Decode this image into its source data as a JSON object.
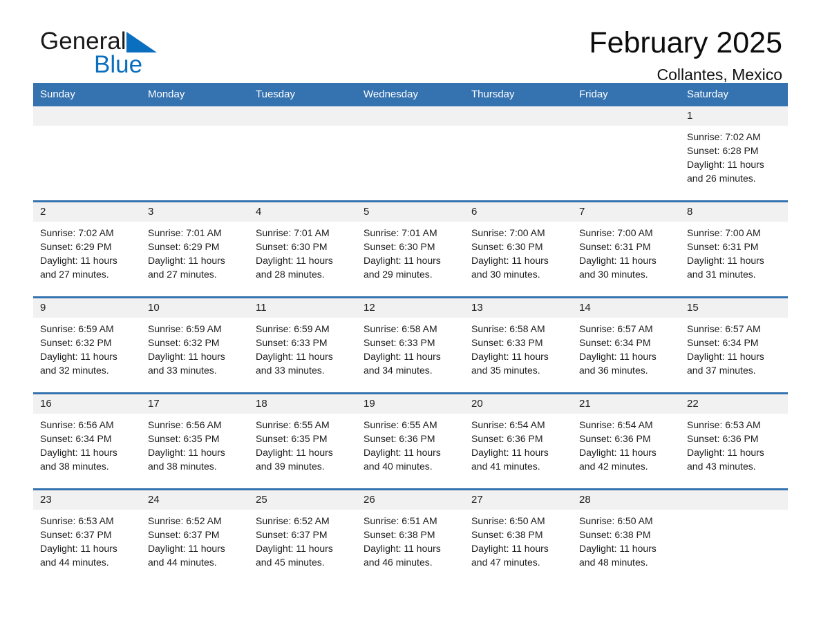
{
  "brand": {
    "word_general": "General",
    "word_blue": "Blue",
    "triangle_color": "#0b6fc0"
  },
  "header": {
    "title": "February 2025",
    "subtitle": "Collantes, Mexico",
    "accent_color": "#3572b0",
    "daynum_band_color": "#f1f1f1"
  },
  "calendar": {
    "weekday_headers": [
      "Sunday",
      "Monday",
      "Tuesday",
      "Wednesday",
      "Thursday",
      "Friday",
      "Saturday"
    ],
    "weeks": [
      [
        {
          "day": "",
          "lines": [
            "",
            "",
            "",
            ""
          ]
        },
        {
          "day": "",
          "lines": [
            "",
            "",
            "",
            ""
          ]
        },
        {
          "day": "",
          "lines": [
            "",
            "",
            "",
            ""
          ]
        },
        {
          "day": "",
          "lines": [
            "",
            "",
            "",
            ""
          ]
        },
        {
          "day": "",
          "lines": [
            "",
            "",
            "",
            ""
          ]
        },
        {
          "day": "",
          "lines": [
            "",
            "",
            "",
            ""
          ]
        },
        {
          "day": "1",
          "lines": [
            "Sunrise: 7:02 AM",
            "Sunset: 6:28 PM",
            "Daylight: 11 hours",
            "and 26 minutes."
          ]
        }
      ],
      [
        {
          "day": "2",
          "lines": [
            "Sunrise: 7:02 AM",
            "Sunset: 6:29 PM",
            "Daylight: 11 hours",
            "and 27 minutes."
          ]
        },
        {
          "day": "3",
          "lines": [
            "Sunrise: 7:01 AM",
            "Sunset: 6:29 PM",
            "Daylight: 11 hours",
            "and 27 minutes."
          ]
        },
        {
          "day": "4",
          "lines": [
            "Sunrise: 7:01 AM",
            "Sunset: 6:30 PM",
            "Daylight: 11 hours",
            "and 28 minutes."
          ]
        },
        {
          "day": "5",
          "lines": [
            "Sunrise: 7:01 AM",
            "Sunset: 6:30 PM",
            "Daylight: 11 hours",
            "and 29 minutes."
          ]
        },
        {
          "day": "6",
          "lines": [
            "Sunrise: 7:00 AM",
            "Sunset: 6:30 PM",
            "Daylight: 11 hours",
            "and 30 minutes."
          ]
        },
        {
          "day": "7",
          "lines": [
            "Sunrise: 7:00 AM",
            "Sunset: 6:31 PM",
            "Daylight: 11 hours",
            "and 30 minutes."
          ]
        },
        {
          "day": "8",
          "lines": [
            "Sunrise: 7:00 AM",
            "Sunset: 6:31 PM",
            "Daylight: 11 hours",
            "and 31 minutes."
          ]
        }
      ],
      [
        {
          "day": "9",
          "lines": [
            "Sunrise: 6:59 AM",
            "Sunset: 6:32 PM",
            "Daylight: 11 hours",
            "and 32 minutes."
          ]
        },
        {
          "day": "10",
          "lines": [
            "Sunrise: 6:59 AM",
            "Sunset: 6:32 PM",
            "Daylight: 11 hours",
            "and 33 minutes."
          ]
        },
        {
          "day": "11",
          "lines": [
            "Sunrise: 6:59 AM",
            "Sunset: 6:33 PM",
            "Daylight: 11 hours",
            "and 33 minutes."
          ]
        },
        {
          "day": "12",
          "lines": [
            "Sunrise: 6:58 AM",
            "Sunset: 6:33 PM",
            "Daylight: 11 hours",
            "and 34 minutes."
          ]
        },
        {
          "day": "13",
          "lines": [
            "Sunrise: 6:58 AM",
            "Sunset: 6:33 PM",
            "Daylight: 11 hours",
            "and 35 minutes."
          ]
        },
        {
          "day": "14",
          "lines": [
            "Sunrise: 6:57 AM",
            "Sunset: 6:34 PM",
            "Daylight: 11 hours",
            "and 36 minutes."
          ]
        },
        {
          "day": "15",
          "lines": [
            "Sunrise: 6:57 AM",
            "Sunset: 6:34 PM",
            "Daylight: 11 hours",
            "and 37 minutes."
          ]
        }
      ],
      [
        {
          "day": "16",
          "lines": [
            "Sunrise: 6:56 AM",
            "Sunset: 6:34 PM",
            "Daylight: 11 hours",
            "and 38 minutes."
          ]
        },
        {
          "day": "17",
          "lines": [
            "Sunrise: 6:56 AM",
            "Sunset: 6:35 PM",
            "Daylight: 11 hours",
            "and 38 minutes."
          ]
        },
        {
          "day": "18",
          "lines": [
            "Sunrise: 6:55 AM",
            "Sunset: 6:35 PM",
            "Daylight: 11 hours",
            "and 39 minutes."
          ]
        },
        {
          "day": "19",
          "lines": [
            "Sunrise: 6:55 AM",
            "Sunset: 6:36 PM",
            "Daylight: 11 hours",
            "and 40 minutes."
          ]
        },
        {
          "day": "20",
          "lines": [
            "Sunrise: 6:54 AM",
            "Sunset: 6:36 PM",
            "Daylight: 11 hours",
            "and 41 minutes."
          ]
        },
        {
          "day": "21",
          "lines": [
            "Sunrise: 6:54 AM",
            "Sunset: 6:36 PM",
            "Daylight: 11 hours",
            "and 42 minutes."
          ]
        },
        {
          "day": "22",
          "lines": [
            "Sunrise: 6:53 AM",
            "Sunset: 6:36 PM",
            "Daylight: 11 hours",
            "and 43 minutes."
          ]
        }
      ],
      [
        {
          "day": "23",
          "lines": [
            "Sunrise: 6:53 AM",
            "Sunset: 6:37 PM",
            "Daylight: 11 hours",
            "and 44 minutes."
          ]
        },
        {
          "day": "24",
          "lines": [
            "Sunrise: 6:52 AM",
            "Sunset: 6:37 PM",
            "Daylight: 11 hours",
            "and 44 minutes."
          ]
        },
        {
          "day": "25",
          "lines": [
            "Sunrise: 6:52 AM",
            "Sunset: 6:37 PM",
            "Daylight: 11 hours",
            "and 45 minutes."
          ]
        },
        {
          "day": "26",
          "lines": [
            "Sunrise: 6:51 AM",
            "Sunset: 6:38 PM",
            "Daylight: 11 hours",
            "and 46 minutes."
          ]
        },
        {
          "day": "27",
          "lines": [
            "Sunrise: 6:50 AM",
            "Sunset: 6:38 PM",
            "Daylight: 11 hours",
            "and 47 minutes."
          ]
        },
        {
          "day": "28",
          "lines": [
            "Sunrise: 6:50 AM",
            "Sunset: 6:38 PM",
            "Daylight: 11 hours",
            "and 48 minutes."
          ]
        },
        {
          "day": "",
          "lines": [
            "",
            "",
            "",
            ""
          ]
        }
      ]
    ]
  }
}
